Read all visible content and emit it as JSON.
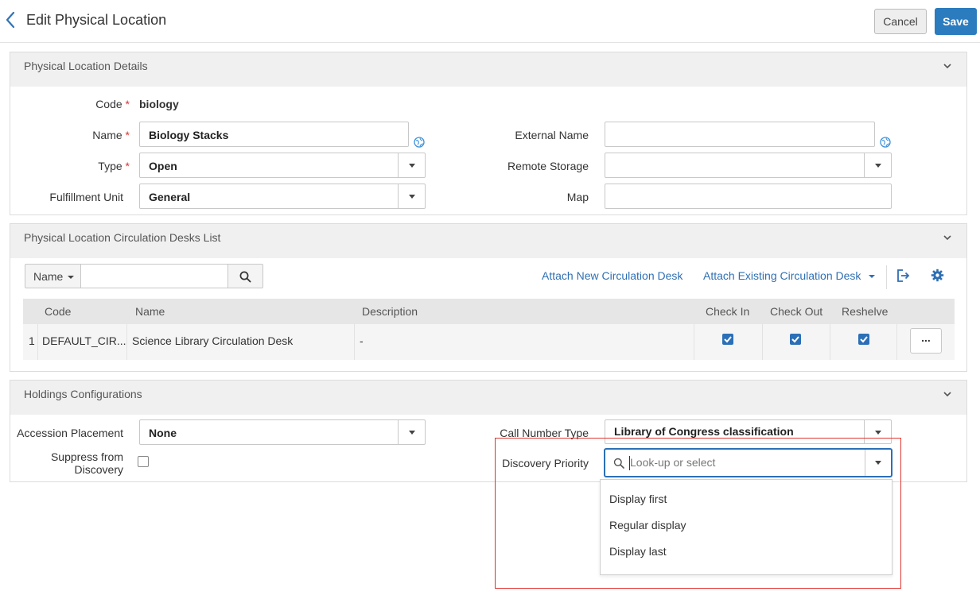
{
  "header": {
    "title": "Edit Physical Location",
    "cancel_label": "Cancel",
    "save_label": "Save"
  },
  "details": {
    "section_title": "Physical Location Details",
    "code_label": "Code",
    "code_value": "biology",
    "name_label": "Name",
    "name_value": "Biology Stacks",
    "type_label": "Type",
    "type_value": "Open",
    "fulfillment_label": "Fulfillment Unit",
    "fulfillment_value": "General",
    "external_name_label": "External Name",
    "external_name_value": "",
    "remote_storage_label": "Remote Storage",
    "remote_storage_value": "",
    "map_label": "Map",
    "map_value": "",
    "required_mark": "*"
  },
  "desks": {
    "section_title": "Physical Location Circulation Desks List",
    "filter_label": "Name",
    "search_value": "",
    "attach_new_label": "Attach New Circulation Desk",
    "attach_existing_label": "Attach Existing Circulation Desk",
    "columns": [
      "Code",
      "Name",
      "Description",
      "Check In",
      "Check Out",
      "Reshelve"
    ],
    "rows": [
      {
        "index": "1",
        "code": "DEFAULT_CIR...",
        "name": "Science Library Circulation Desk",
        "description": "-",
        "check_in": true,
        "check_out": true,
        "reshelve": true,
        "actions": "..."
      }
    ]
  },
  "holdings": {
    "section_title": "Holdings Configurations",
    "accession_label": "Accession Placement",
    "accession_value": "None",
    "suppress_label_line1": "Suppress from",
    "suppress_label_line2": "Discovery",
    "suppress_checked": false,
    "call_number_label": "Call Number Type",
    "call_number_value": "Library of Congress classification",
    "discovery_label": "Discovery Priority",
    "discovery_placeholder": "Look-up or select",
    "discovery_options": [
      "Display first",
      "Regular display",
      "Display last"
    ]
  },
  "colors": {
    "accent": "#2b7bbf",
    "link": "#2f6fb3",
    "highlight_box": "#e0342f",
    "required": "#dd3333"
  }
}
